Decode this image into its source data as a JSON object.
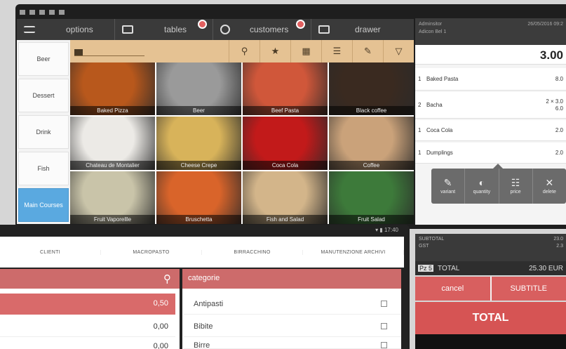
{
  "back_tablet": {
    "statusbar": {
      "time": ""
    },
    "topbar": [
      {
        "label": "options",
        "icon": "menu-icon"
      },
      {
        "label": "tables",
        "icon": "table-icon",
        "badge": true
      },
      {
        "label": "customers",
        "icon": "customer-icon",
        "badge": true
      },
      {
        "label": "drawer",
        "icon": "drawer-icon"
      }
    ],
    "categories": [
      "Beer",
      "Dessert",
      "Drink",
      "Fish",
      "Main Courses"
    ],
    "active_category": "Main Courses",
    "toolbar_icons": [
      "search-icon",
      "star-icon",
      "grid-icon",
      "list-icon",
      "edit-icon",
      "filter-icon"
    ],
    "products": [
      {
        "label": "Baked Pizza",
        "color": "#b8581c"
      },
      {
        "label": "Beer",
        "color": "#9a9a9a"
      },
      {
        "label": "Beef Pasta",
        "color": "#d0573a"
      },
      {
        "label": "Black coffee",
        "color": "#3a2a20"
      },
      {
        "label": "Chateau de Montalier",
        "color": "#eceae6"
      },
      {
        "label": "Cheese Crepe",
        "color": "#d8b35a"
      },
      {
        "label": "Coca Cola",
        "color": "#c21a1a"
      },
      {
        "label": "Coffee",
        "color": "#caa27a"
      },
      {
        "label": "Fruit Vaporellle",
        "color": "#c9c4a9"
      },
      {
        "label": "Bruschetta",
        "color": "#d9642a"
      },
      {
        "label": "Fish and Salad",
        "color": "#d3b58a"
      },
      {
        "label": "Fruit Salad",
        "color": "#3d7a3a"
      }
    ],
    "receipt": {
      "header_left": "Adminsitor",
      "header_left2": "Adicon Bel 1",
      "header_right": "26/05/2016 09:2",
      "total": "3.00",
      "lines": [
        {
          "qty": "1",
          "name": "Baked Pasta",
          "price": "8.0"
        },
        {
          "qty": "2",
          "name": "Bacha",
          "price": "2 × 3.0",
          "price2": "6.0"
        },
        {
          "qty": "1",
          "name": "Coca Cola",
          "price": "2.0"
        },
        {
          "qty": "1",
          "name": "Dumplings",
          "price": "2.0"
        }
      ],
      "actions": [
        {
          "label": "variant",
          "glyph": "✎",
          "icon": "variant-icon"
        },
        {
          "label": "quantity",
          "glyph": "◐",
          "icon": "quantity-icon"
        },
        {
          "label": "price",
          "glyph": "☷",
          "icon": "price-icon"
        },
        {
          "label": "delete",
          "glyph": "✕",
          "icon": "delete-icon"
        }
      ]
    }
  },
  "front_tablet": {
    "status_time": "17:40",
    "tabs": [
      "CLIENTI",
      "MACROPASTO",
      "BIRRACCHINO",
      "MANUTENZIONE ARCHIVI"
    ],
    "category_label": "categorie",
    "values": [
      "0,50",
      "0,00",
      "0,00"
    ],
    "categories": [
      "Antipasti",
      "Bibite",
      "Birre"
    ]
  },
  "checkout": {
    "subtotal_label": "SUBTOTAL",
    "subtotal_value": "23.0",
    "tax_label": "GST",
    "tax_value": "2.3",
    "total_row_left": "Pz 5",
    "total_row_label": "TOTAL",
    "total_row_value": "25.30 EUR",
    "cancel_label": "cancel",
    "button2_label": "SUBTITLE",
    "total_button": "TOTAL"
  }
}
